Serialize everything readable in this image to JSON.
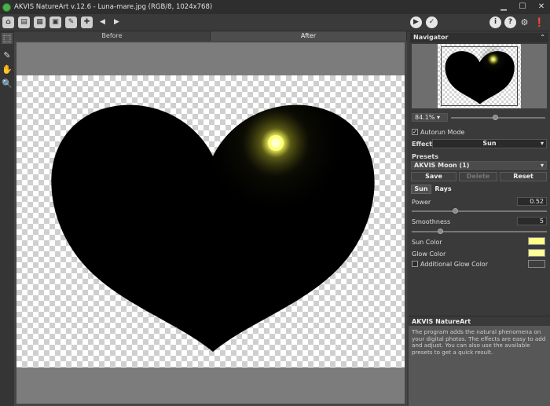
{
  "window": {
    "title": "AKVIS NatureArt v.12.6 - Luna-mare.jpg (RGB/8, 1024x768)"
  },
  "canvas": {
    "tabs": [
      {
        "label": "Before"
      },
      {
        "label": "After"
      }
    ]
  },
  "panel": {
    "navigator": {
      "title": "Navigator",
      "zoom": "84.1%"
    },
    "autorun": {
      "label": "Autorun Mode",
      "checked": true
    },
    "effect": {
      "label": "Effect:",
      "value": "Sun"
    },
    "presets": {
      "title": "Presets",
      "value": "AKVIS Moon (1)",
      "save": "Save",
      "delete": "Delete",
      "reset": "Reset"
    },
    "tabs": {
      "sun": "Sun",
      "rays": "Rays"
    },
    "power": {
      "label": "Power",
      "value": "0.52"
    },
    "smoothness": {
      "label": "Smoothness",
      "value": "5"
    },
    "sun_color": {
      "label": "Sun Color",
      "color": "#ffff88"
    },
    "glow_color": {
      "label": "Glow Color",
      "color": "#ffff99"
    },
    "additional_glow": {
      "label": "Additional Glow Color",
      "checked": false
    }
  },
  "info": {
    "title": "AKVIS NatureArt",
    "text": "The program adds the natural phenomena on your digital photos. The effects are easy to add and adjust. You can also use the available presets to get a quick result."
  }
}
